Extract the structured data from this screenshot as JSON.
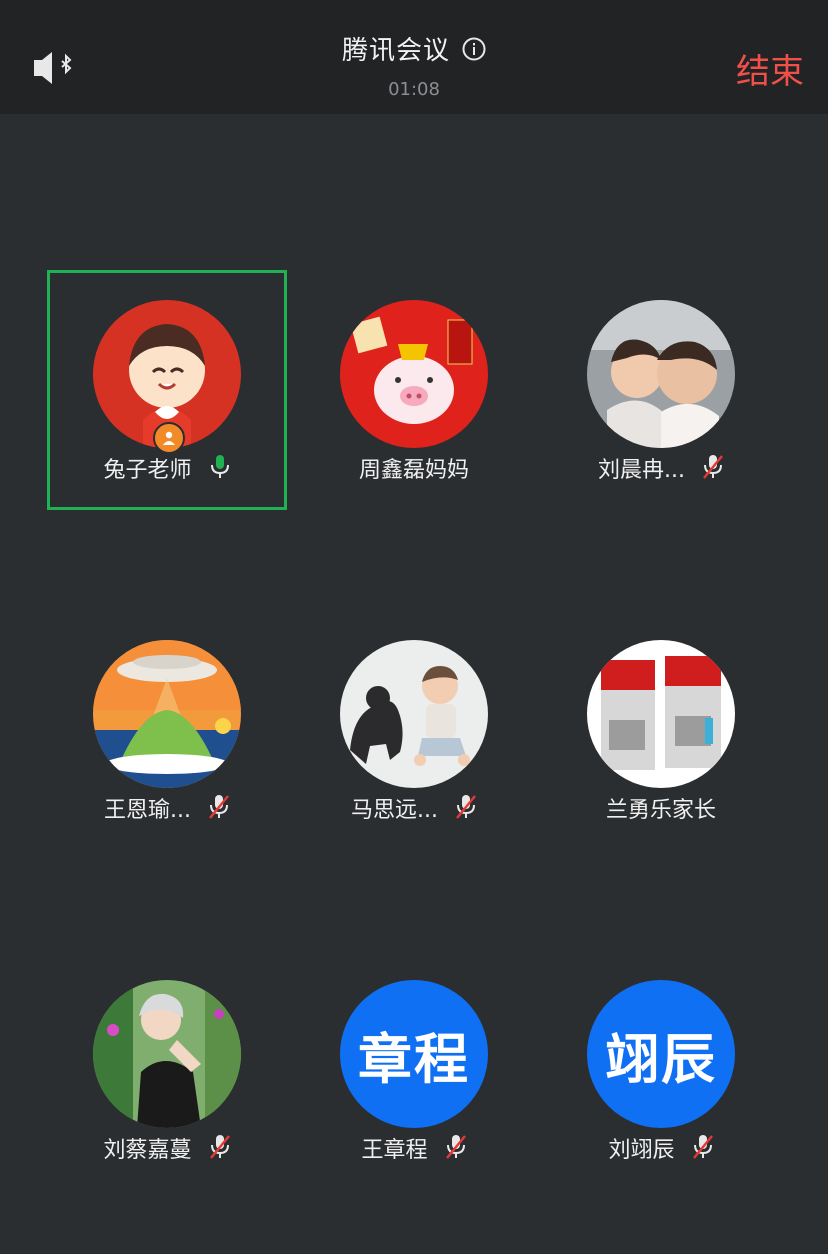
{
  "header": {
    "title": "腾讯会议",
    "timer": "01:08",
    "end_label": "结束",
    "speaker_icon": "speaker-bluetooth-icon",
    "info_icon": "info-icon"
  },
  "colors": {
    "end": "#f0504a",
    "selected_outline": "#1fb152",
    "avatar_blue": "#1070f3",
    "mic_active": "#1fb152",
    "mic_muted_slash": "#e53935"
  },
  "participants": [
    {
      "name": "兔子老师",
      "mic": "active",
      "host": true,
      "selected": true
    },
    {
      "name": "周鑫磊妈妈",
      "mic": "none"
    },
    {
      "name": "刘晨冉...",
      "mic": "muted"
    },
    {
      "name": "王恩瑜...",
      "mic": "muted"
    },
    {
      "name": "马思远...",
      "mic": "muted"
    },
    {
      "name": "兰勇乐家长",
      "mic": "none"
    },
    {
      "name": "刘蔡嘉蔓",
      "mic": "muted"
    },
    {
      "name": "王章程",
      "mic": "muted",
      "avatar_text": "章程"
    },
    {
      "name": "刘翊辰",
      "mic": "muted",
      "avatar_text": "翊辰"
    }
  ]
}
